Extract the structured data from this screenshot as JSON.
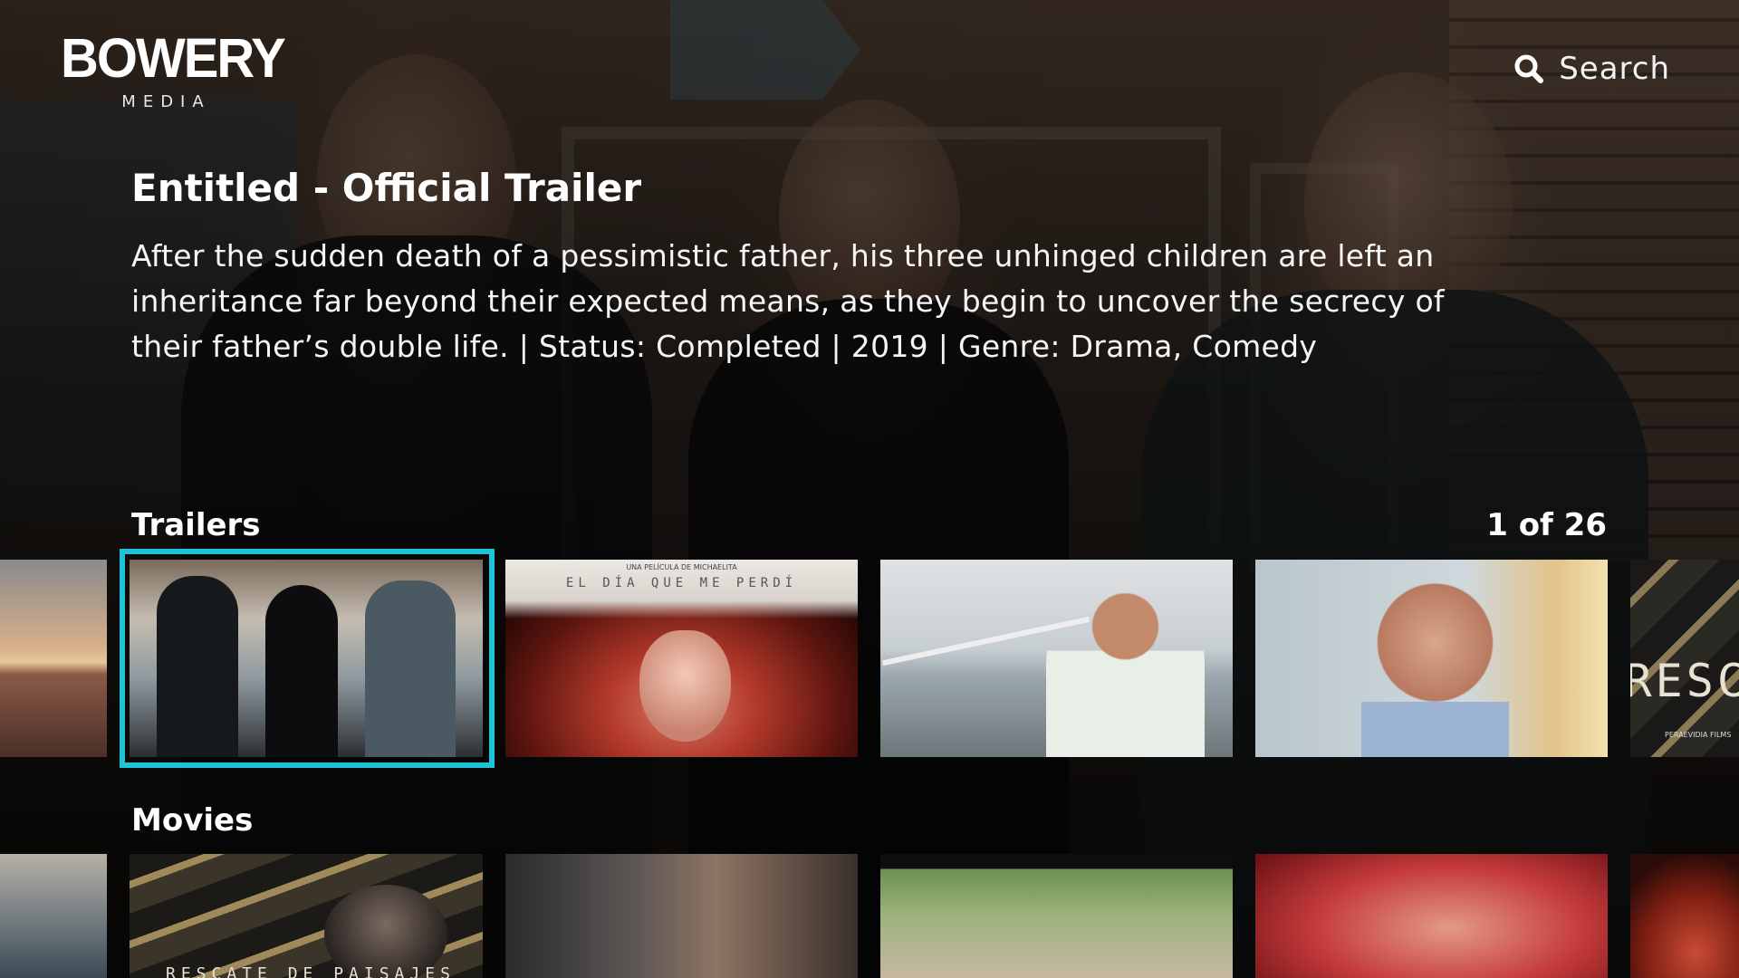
{
  "app": {
    "logo_main": "BOWERY",
    "logo_sub": "MEDIA"
  },
  "header": {
    "search_label": "Search",
    "search_icon": "search-icon"
  },
  "detail": {
    "title": "Entitled - Official Trailer",
    "description": "After the sudden death of a pessimistic father, his three unhinged children are left an inheritance far beyond their expected means, as they begin to uncover the secrecy of their father’s double life. | Status: Completed | 2019 | Genre: Drama, Comedy"
  },
  "rows": {
    "trailers": {
      "title": "Trailers",
      "count": "1 of 26",
      "focused_index": 1
    },
    "movies": {
      "title": "Movies"
    }
  },
  "tiles": {
    "perdi_line1": "UNA PELÍCULA DE MICHAELITA",
    "perdi_title": "EL DÍA QUE ME PERDÍ",
    "resc_title": "RESC",
    "resc_sub": "PERAEVIDIA FILMS",
    "m1_title": "RESCATE DE PAISAJES"
  },
  "colors": {
    "focus_ring": "#1ec4d6",
    "background": "#1a1714",
    "text": "#ffffff"
  }
}
